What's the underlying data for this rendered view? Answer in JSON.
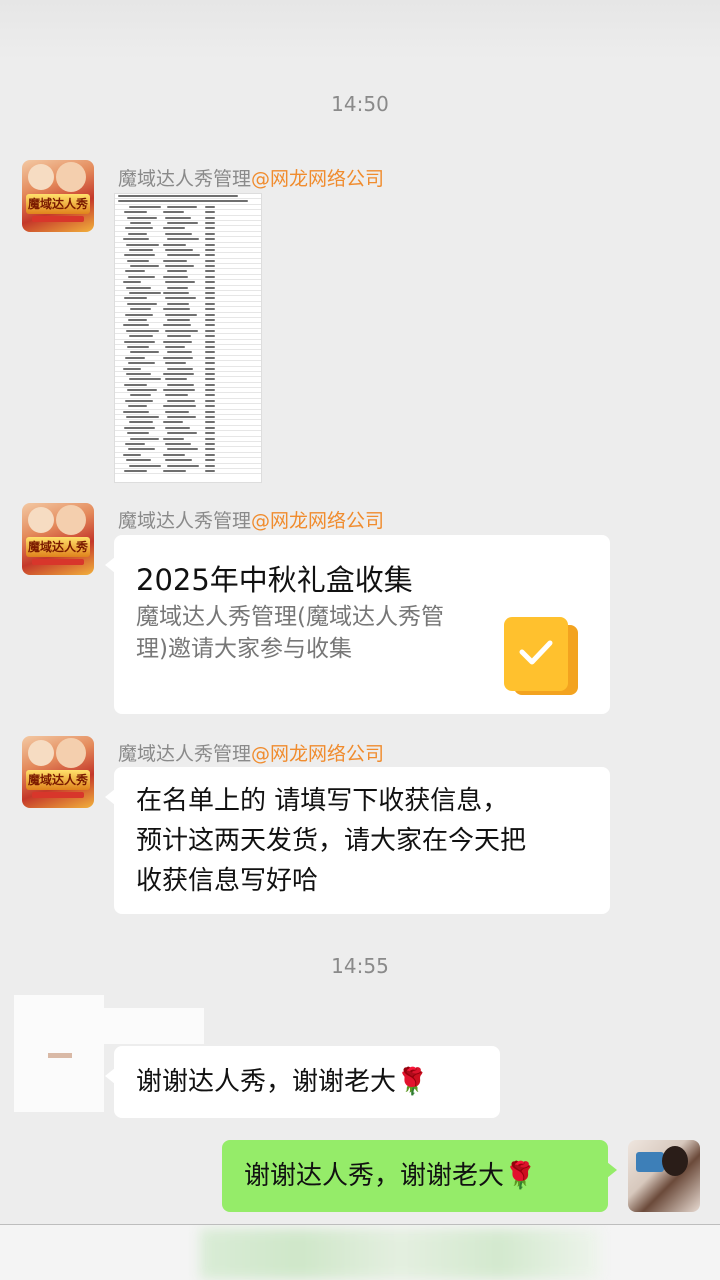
{
  "timestamps": [
    "14:50",
    "14:55"
  ],
  "group_sender": {
    "name": "魔域达人秀管理",
    "org": "@网龙网络公司",
    "avatar_logo": "魔域达人秀"
  },
  "messages": {
    "image_sheet": {
      "type": "image",
      "description_icon": "spreadsheet-thumbnail"
    },
    "collection_card": {
      "title": "2025年中秋礼盒收集",
      "description": "魔域达人秀管理(魔域达人秀管理)邀请大家参与收集",
      "icon": "checkmark-doc-icon"
    },
    "notice": {
      "lines": [
        "在名单上的 请填写下收获信息，",
        "预计这两天发货，请大家在今天把",
        "收获信息写好哈"
      ]
    },
    "reply_other": {
      "text": "谢谢达人秀，谢谢老大",
      "emoji": "🌹"
    },
    "reply_self": {
      "text": "谢谢达人秀，谢谢老大",
      "emoji": "🌹"
    }
  },
  "colors": {
    "background": "#ededed",
    "sender_name": "#8a8a8a",
    "sender_org": "#f08c2e",
    "self_bubble": "#95ec69",
    "card_icon": "#ffc12e"
  }
}
